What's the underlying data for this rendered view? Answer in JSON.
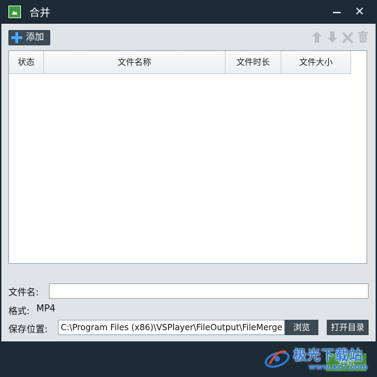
{
  "window": {
    "title": "合并",
    "minimize_icon": "minimize-icon",
    "close_icon": "close-icon",
    "close_glyph": "✕"
  },
  "toolbar": {
    "add_label": "添加",
    "icons": [
      "arrow-up-icon",
      "arrow-down-icon",
      "remove-x-icon",
      "trash-icon"
    ]
  },
  "table": {
    "columns": [
      "状态",
      "文件名称",
      "文件时长",
      "文件大小"
    ],
    "rows": []
  },
  "form": {
    "file_name_label": "文件名:",
    "file_name_value": "",
    "format_label": "格式:",
    "format_value": "MP4",
    "save_path_label": "保存位置:",
    "save_path_value": "C:\\Program Files (x86)\\VSPlayer\\FileOutput\\FileMerge",
    "browse_label": "浏览",
    "open_dir_label": "打开目录"
  },
  "footer": {
    "start_label": "开始",
    "watermark_text": "极光下载站",
    "watermark_url": "www.xz7.com"
  },
  "colors": {
    "titlebar": "#1c2b35",
    "client": "#dfe4e8",
    "button": "#3b4a55",
    "accent_blue": "#4aa8ff",
    "start_green": "#4a9b45"
  }
}
